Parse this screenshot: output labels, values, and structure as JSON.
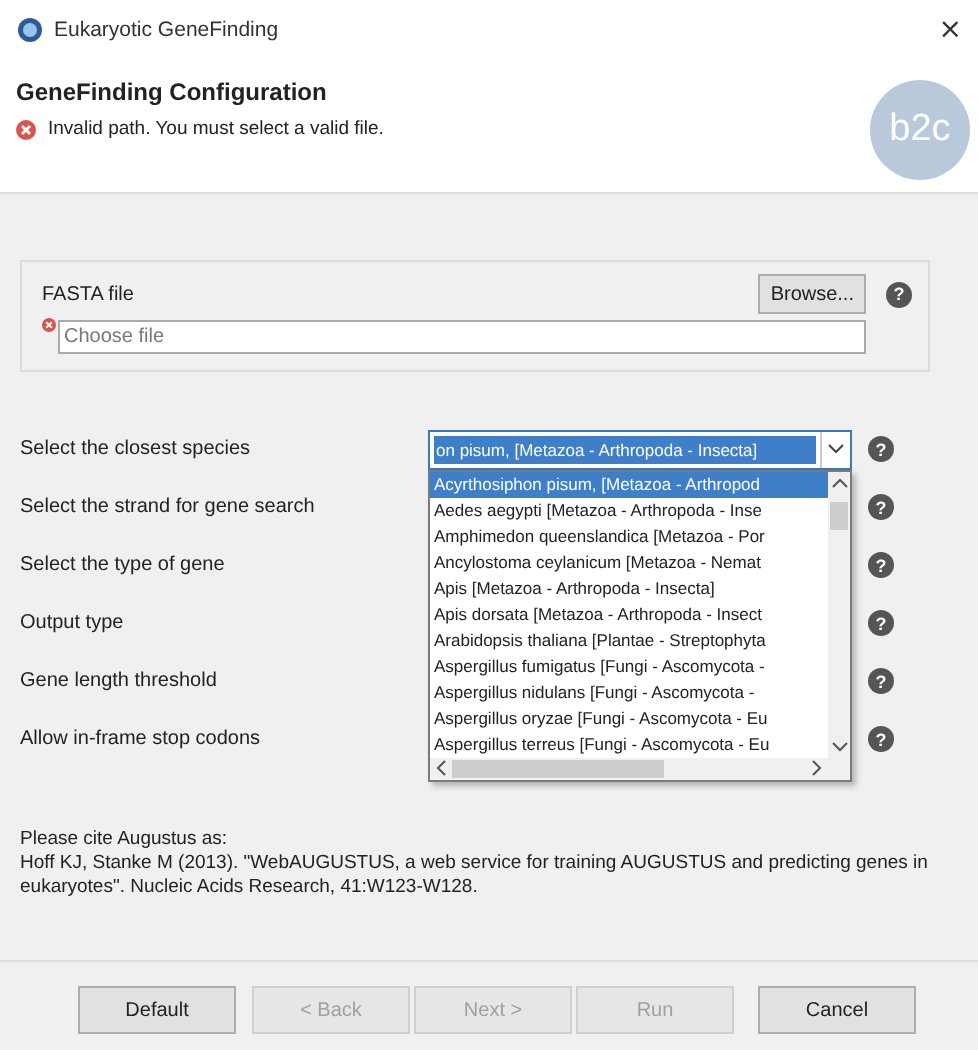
{
  "window": {
    "title": "Eukaryotic GeneFinding",
    "close": "×"
  },
  "header": {
    "title": "GeneFinding Configuration",
    "error": "Invalid path. You must select a valid file.",
    "logo": "b2c"
  },
  "fasta": {
    "label": "FASTA file",
    "browse": "Browse...",
    "help": "?",
    "placeholder": "Choose file",
    "error": true
  },
  "options": [
    {
      "kind": "combo",
      "label": "Select the closest species",
      "help": "?",
      "value": "on pisum, [Metazoa - Arthropoda - Insecta]",
      "expanded": true,
      "items": [
        {
          "label": "Acyrthosiphon pisum, [Metazoa - Arthropod",
          "selected": true
        },
        {
          "label": "Aedes aegypti [Metazoa - Arthropoda - Inse",
          "selected": false
        },
        {
          "label": "Amphimedon queenslandica [Metazoa - Por",
          "selected": false
        },
        {
          "label": "Ancylostoma ceylanicum [Metazoa - Nemat",
          "selected": false
        },
        {
          "label": "Apis [Metazoa - Arthropoda - Insecta]",
          "selected": false
        },
        {
          "label": "Apis dorsata [Metazoa - Arthropoda - Insect",
          "selected": false
        },
        {
          "label": "Arabidopsis thaliana [Plantae - Streptophyta",
          "selected": false
        },
        {
          "label": "Aspergillus fumigatus [Fungi - Ascomycota -",
          "selected": false
        },
        {
          "label": "Aspergillus nidulans [Fungi - Ascomycota -",
          "selected": false
        },
        {
          "label": "Aspergillus oryzae [Fungi - Ascomycota - Eu",
          "selected": false
        },
        {
          "label": "Aspergillus terreus [Fungi - Ascomycota - Eu",
          "selected": false
        }
      ]
    },
    {
      "kind": "label",
      "label": "Select the strand for gene search",
      "help": "?"
    },
    {
      "kind": "label",
      "label": "Select the type of gene",
      "help": "?"
    },
    {
      "kind": "label",
      "label": "Output type",
      "help": "?"
    },
    {
      "kind": "label",
      "label": "Gene length threshold",
      "help": "?"
    },
    {
      "kind": "label",
      "label": "Allow in-frame stop codons",
      "help": "?"
    }
  ],
  "citation": {
    "heading": "Please cite Augustus as:",
    "text": "Hoff KJ, Stanke M (2013). \"WebAUGUSTUS, a web service for training AUGUSTUS and predicting genes in eukaryotes\". Nucleic Acids Research, 41:W123-W128."
  },
  "buttons": [
    {
      "label": "Default",
      "disabled": false
    },
    {
      "label": "< Back",
      "disabled": true
    },
    {
      "label": "Next >",
      "disabled": true
    },
    {
      "label": "Run",
      "disabled": true
    },
    {
      "label": "Cancel",
      "disabled": false
    }
  ]
}
